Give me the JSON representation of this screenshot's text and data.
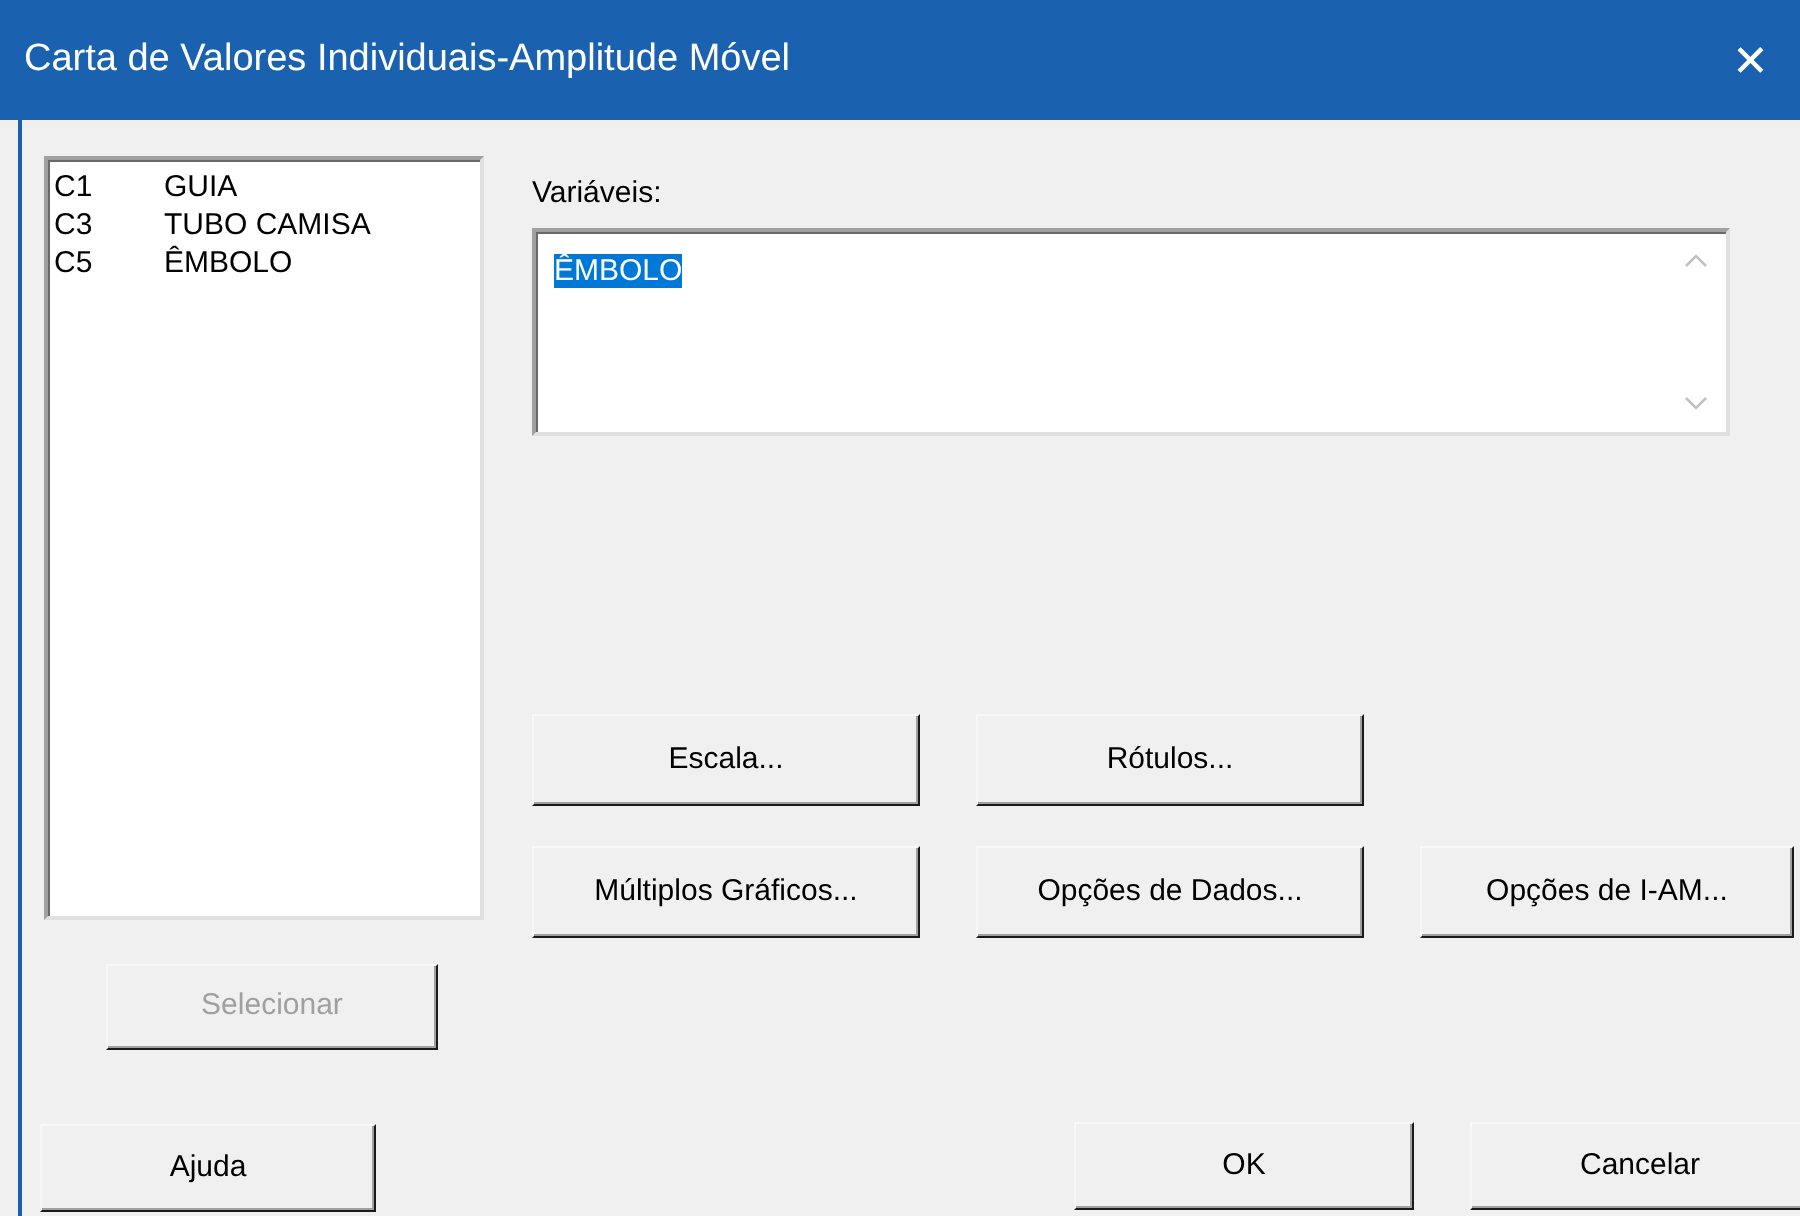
{
  "window": {
    "title": "Carta de Valores Individuais-Amplitude Móvel",
    "close": "✕"
  },
  "columns": [
    {
      "id": "C1",
      "name": "GUIA"
    },
    {
      "id": "C3",
      "name": "TUBO CAMISA"
    },
    {
      "id": "C5",
      "name": "ÊMBOLO"
    }
  ],
  "variables": {
    "label": "Variáveis:",
    "value": "ÊMBOLO",
    "value_selected": true
  },
  "option_buttons": [
    {
      "label": "Escala..."
    },
    {
      "label": "Rótulos..."
    },
    {
      "label": "Múltiplos Gráficos..."
    },
    {
      "label": "Opções de Dados..."
    },
    {
      "label": "Opções de I-AM..."
    }
  ],
  "select_button": {
    "label": "Selecionar",
    "disabled": true
  },
  "help_button": {
    "label": "Ajuda"
  },
  "ok_button": {
    "label": "OK"
  },
  "cancel_button": {
    "label": "Cancelar"
  }
}
